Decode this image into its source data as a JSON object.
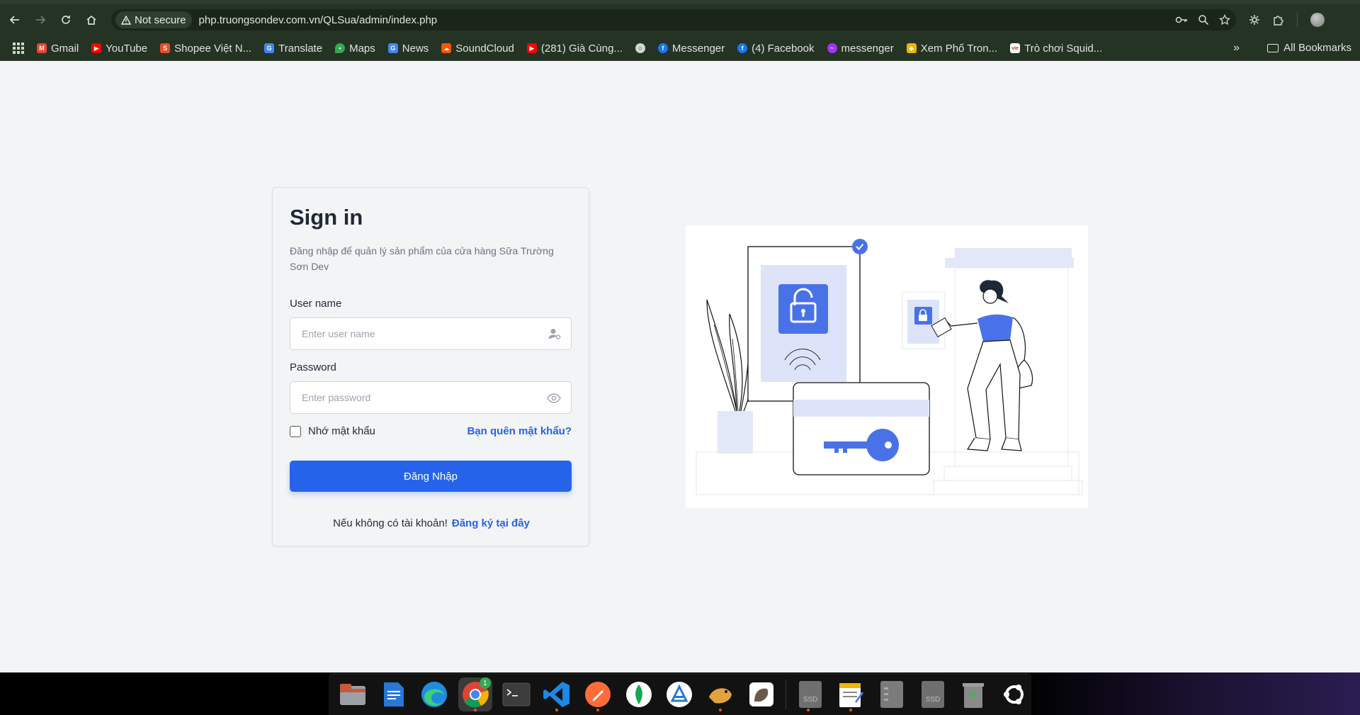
{
  "browser": {
    "not_secure_label": "Not secure",
    "url": "php.truongsondev.com.vn/QLSua/admin/index.php",
    "bookmarks": [
      {
        "label": "Gmail",
        "icon": "gmail-icon",
        "color": "#ea4335"
      },
      {
        "label": "YouTube",
        "icon": "youtube-icon",
        "color": "#ff0000"
      },
      {
        "label": "Shopee Việt N...",
        "icon": "shopee-icon",
        "color": "#ee4d2d"
      },
      {
        "label": "Translate",
        "icon": "translate-icon",
        "color": "#4285f4"
      },
      {
        "label": "Maps",
        "icon": "maps-icon",
        "color": "#34a853"
      },
      {
        "label": "News",
        "icon": "news-icon",
        "color": "#4285f4"
      },
      {
        "label": "SoundCloud",
        "icon": "soundcloud-icon",
        "color": "#ff5500"
      },
      {
        "label": "(281) Già Cùng...",
        "icon": "youtube-icon",
        "color": "#ff0000"
      },
      {
        "label": "",
        "icon": "globe-icon",
        "color": "#cfd7cf"
      },
      {
        "label": "Messenger",
        "icon": "facebook-icon",
        "color": "#1877f2"
      },
      {
        "label": "(4) Facebook",
        "icon": "facebook-icon",
        "color": "#1877f2"
      },
      {
        "label": "messenger",
        "icon": "messenger-icon",
        "color": "#a033ff"
      },
      {
        "label": "Xem Phố Tron...",
        "icon": "cube-icon",
        "color": "#f4b400"
      },
      {
        "label": "Trò chơi Squid...",
        "icon": "vie-icon",
        "color": "#d32f2f"
      }
    ],
    "all_bookmarks_label": "All Bookmarks"
  },
  "login": {
    "title": "Sign in",
    "subtitle": "Đăng nhập để quản lý sản phẩm của cửa hàng Sữa Trường Sơn Dev",
    "username_label": "User name",
    "username_placeholder": "Enter user name",
    "password_label": "Password",
    "password_placeholder": "Enter password",
    "remember_label": "Nhớ mật khẩu",
    "forgot_label": "Bạn quên mật khẩu?",
    "submit_label": "Đăng Nhập",
    "no_account_text": "Nếu không có tài khoản!",
    "signup_link": "Đăng ký tại đây"
  },
  "dock": {
    "chrome_badge": "1",
    "ssd_label": "SSD",
    "items": [
      "files-icon",
      "writer-icon",
      "edge-icon",
      "chrome-icon",
      "terminal-icon",
      "vscode-icon",
      "postman-icon",
      "mongodb-icon",
      "app-center-icon",
      "dbeaver-icon",
      "gimp-icon",
      "ssd-drive-icon",
      "text-editor-icon",
      "drive-icon",
      "ssd-drive-icon",
      "trash-icon",
      "ubuntu-icon"
    ]
  },
  "colors": {
    "accent": "#2563eb",
    "illustration_accent": "#4a72e8"
  }
}
